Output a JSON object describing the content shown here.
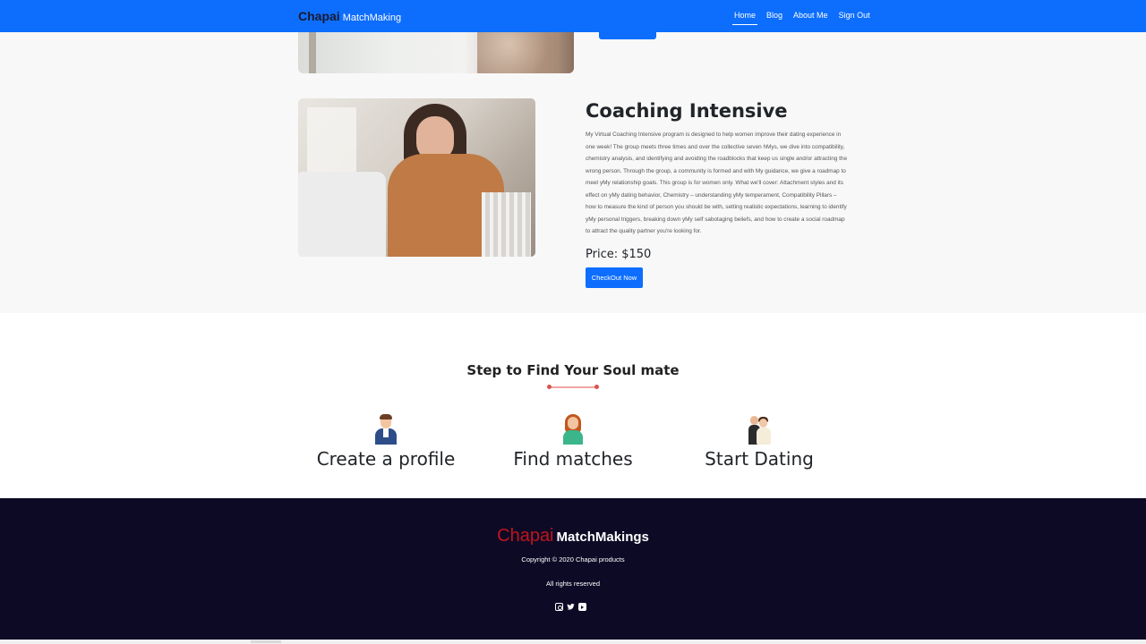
{
  "navbar": {
    "brand_primary": "Chapai",
    "brand_secondary": "MatchMaking",
    "links": [
      "Home",
      "Blog",
      "About Me",
      "Sign Out"
    ],
    "active_link": "Home"
  },
  "coaching": {
    "title": "Coaching Intensive",
    "description": "My Virtual Coaching Intensive program is designed to help women improve their dating experience in one week! The group meets three times and over the collective seven hMys, we dive into compatibility, chemistry analysis, and identifying and avoiding the roadblocks that keep us single and/or attracting the wrong person. Through the group, a community is formed and with My guidance, we give a roadmap to meet yMy relationship goals. This group is for women only. What we'll cover: Attachment styles and its effect on yMy dating behavior, Chemistry – understanding yMy temperament, Compatibility Pillars – how to measure the kind of person you should be with, setting realistic expectations, learning to identify yMy personal triggers, breaking down yMy self sabotaging beliefs, and how to create a social roadmap to attract the quality partner you're looking for.",
    "price": "Price: $150",
    "checkout_label": "CheckOut Now"
  },
  "steps": {
    "title": "Step to Find Your Soul mate",
    "items": [
      {
        "label": "Create a profile",
        "icon": "man-avatar-icon"
      },
      {
        "label": "Find matches",
        "icon": "woman-avatar-icon"
      },
      {
        "label": "Start Dating",
        "icon": "couple-icon"
      }
    ]
  },
  "footer": {
    "brand_primary": "Chapai",
    "brand_secondary": "MatchMakings",
    "copyright": "Copyright © 2020 Chapai products",
    "rights": "All rights reserved",
    "social": [
      "instagram-icon",
      "twitter-icon",
      "youtube-icon"
    ]
  },
  "colors": {
    "primary": "#0d6efd",
    "footer_bg": "#0d0a26",
    "brand_red": "#c0141c"
  }
}
